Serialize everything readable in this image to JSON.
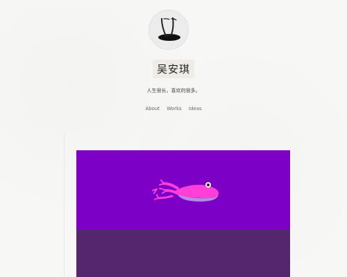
{
  "profile": {
    "avatar_icon": "feet-in-water-avatar-icon",
    "name": "吴安琪",
    "tagline": "人生很长，喜欢的很多。"
  },
  "nav": {
    "items": [
      {
        "label": "About"
      },
      {
        "label": "Works"
      },
      {
        "label": "Ideas"
      }
    ]
  },
  "media": {
    "illustration": "frog-swimming-icon",
    "colors": {
      "top": "#7c00c6",
      "bottom": "#55266d",
      "frog": "#ff3fd7",
      "belly": "#b78be6"
    }
  }
}
